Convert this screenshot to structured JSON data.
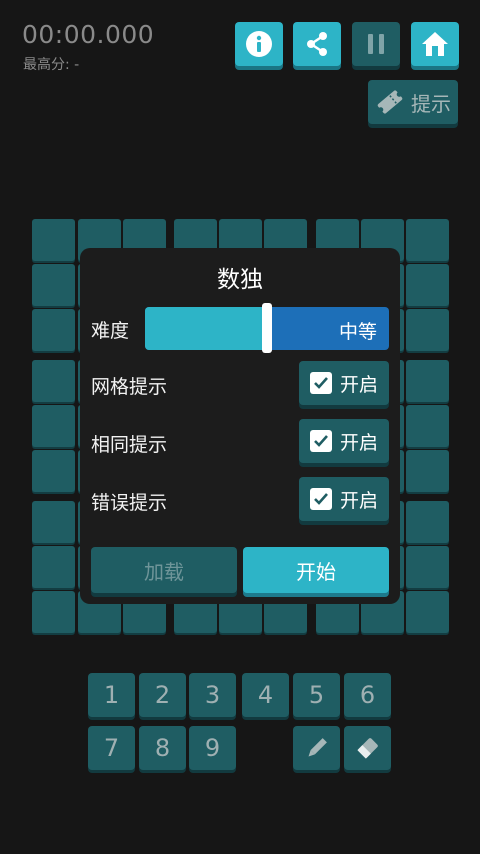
{
  "header": {
    "timer": "00:00.000",
    "best_score": "最高分: -",
    "buttons": [
      {
        "name": "info-button",
        "icon": "info-icon",
        "style": "light"
      },
      {
        "name": "share-button",
        "icon": "share-icon",
        "style": "light"
      },
      {
        "name": "pause-button",
        "icon": "pause-icon",
        "style": "dark"
      },
      {
        "name": "home-button",
        "icon": "home-icon",
        "style": "light"
      }
    ],
    "hint_label": "提示",
    "hint_icon": "ticket-icon"
  },
  "dialog": {
    "title": "数独",
    "difficulty_label": "难度",
    "difficulty_value": "中等",
    "difficulty_level": 0.5,
    "options": [
      {
        "label": "网格提示",
        "toggle_label": "开启",
        "checked": true
      },
      {
        "label": "相同提示",
        "toggle_label": "开启",
        "checked": true
      },
      {
        "label": "错误提示",
        "toggle_label": "开启",
        "checked": true
      }
    ],
    "load_label": "加载",
    "start_label": "开始"
  },
  "keypad": {
    "numbers": [
      "1",
      "2",
      "3",
      "4",
      "5",
      "6",
      "7",
      "8",
      "9"
    ],
    "tools": [
      {
        "name": "pencil-button",
        "icon": "pencil-icon"
      },
      {
        "name": "eraser-button",
        "icon": "eraser-icon"
      }
    ]
  },
  "colors": {
    "accent": "#2db4c7",
    "cell": "#1f5d63",
    "background": "#161616",
    "slider_right": "#1d6fb8"
  }
}
